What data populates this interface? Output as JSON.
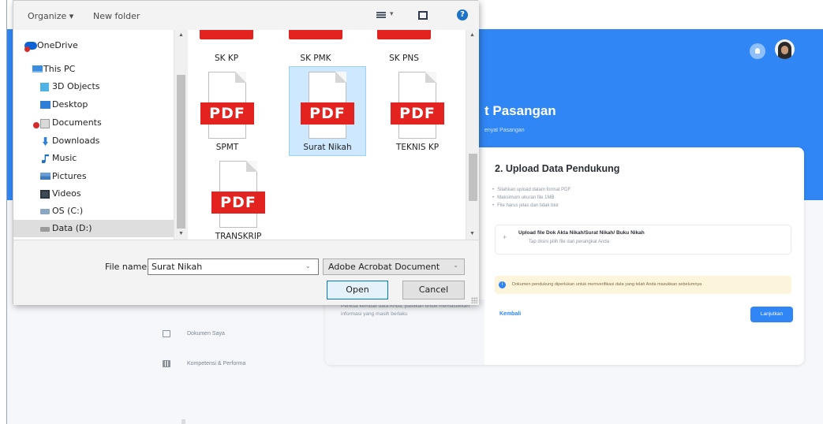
{
  "app": {
    "page_title": "t Pasangan",
    "page_subtitle": "enyat Pasangan",
    "section_title": "2. Upload Data Pendukung",
    "bullets": [
      "Silahkan upload dalam format PDF",
      "Maksimum ukuran file 1MB",
      "File harus jelas dan tidak blur"
    ],
    "upload": {
      "plus": "+",
      "title": "Upload file Dok Akta Nikah/Surat Nikah/ Buku Nikah",
      "hint": "Tap disini pilih file dari perangkat Anda"
    },
    "info_icon": "i",
    "info_text": "Dokumen pendukung diperlukan untuk memverifikasi data yang telah Anda masukkan sebelumnya",
    "back_label": "Kembali",
    "next_label": "Lanjutkan",
    "card_left_text": "Periksa kembali data Anda, pastikan untuk memasukkan informasi yang masih berlaku",
    "side_menu": [
      {
        "label": "Dokumen Saya",
        "icon": "folder-icon"
      },
      {
        "label": "Kompetensi & Performa",
        "icon": "grid-icon"
      }
    ]
  },
  "dialog": {
    "toolbar": {
      "organize": "Organize ▾",
      "new_folder": "New folder",
      "view_caret": "▾",
      "help": "?"
    },
    "nav_items": [
      {
        "label": "OneDrive",
        "icon": "onedrive-icon"
      },
      {
        "label": "This PC",
        "icon": "pc-icon"
      },
      {
        "label": "3D Objects",
        "icon": "cube-icon"
      },
      {
        "label": "Desktop",
        "icon": "desktop-icon"
      },
      {
        "label": "Documents",
        "icon": "documents-icon"
      },
      {
        "label": "Downloads",
        "icon": "download-icon"
      },
      {
        "label": "Music",
        "icon": "music-icon"
      },
      {
        "label": "Pictures",
        "icon": "pictures-icon"
      },
      {
        "label": "Videos",
        "icon": "videos-icon"
      },
      {
        "label": "OS (C:)",
        "icon": "drive-icon"
      },
      {
        "label": "Data (D:)",
        "icon": "drive-icon"
      }
    ],
    "files_top": [
      "SK KP",
      "SK PMK",
      "SK PNS"
    ],
    "files": [
      {
        "name": "SPMT",
        "badge": "PDF"
      },
      {
        "name": "Surat Nikah",
        "badge": "PDF"
      },
      {
        "name": "TEKNIS KP",
        "badge": "PDF"
      },
      {
        "name": "TRANSKRIP",
        "badge": "PDF"
      }
    ],
    "file_name_label": "File name:",
    "file_name_value": "Surat Nikah",
    "file_type": "Adobe Acrobat Document",
    "open_label": "Open",
    "cancel_label": "Cancel",
    "scroll_up": "▲",
    "scroll_down": "▼",
    "select_caret": "⌄"
  },
  "colors": {
    "brand_blue": "#2f86f4",
    "pdf_red": "#e3231f",
    "selection": "#cde8ff"
  }
}
